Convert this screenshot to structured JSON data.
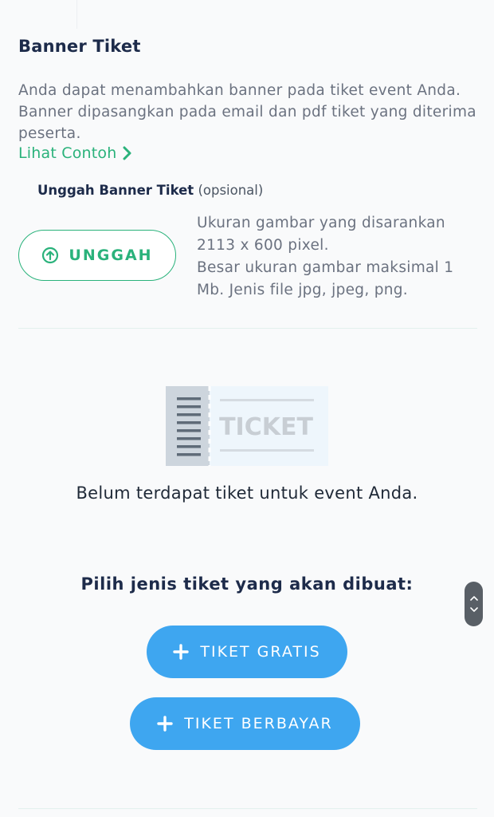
{
  "banner": {
    "title": "Banner Tiket",
    "description": "Anda dapat menambahkan banner pada tiket event Anda. Banner dipasangkan pada email dan pdf tiket yang diterima peserta.",
    "see_example": "Lihat Contoh",
    "upload_label": "Unggah Banner Tiket",
    "upload_optional": "(opsional)",
    "upload_button": "UNGGAH",
    "hint_lines": [
      "Ukuran gambar yang disarankan",
      "2113 x 600 pixel.",
      "Besar ukuran gambar maksimal 1",
      "Mb. Jenis file jpg, jpeg, png."
    ],
    "accent_color": "#2ab27b"
  },
  "tickets": {
    "illustration_text": "TICKET",
    "empty_message": "Belum terdapat tiket untuk event Anda.",
    "choose_prompt": "Pilih jenis tiket yang akan dibuat:",
    "free_button": "TIKET GRATIS",
    "paid_button": "TIKET BERBAYAR",
    "button_color": "#3ea6f0"
  },
  "icons": {
    "see_example": "chevron-right-icon",
    "upload": "arrow-up-circle-icon",
    "add": "plus-icon",
    "scroll_up": "chevron-up-icon",
    "scroll_down": "chevron-down-icon"
  }
}
